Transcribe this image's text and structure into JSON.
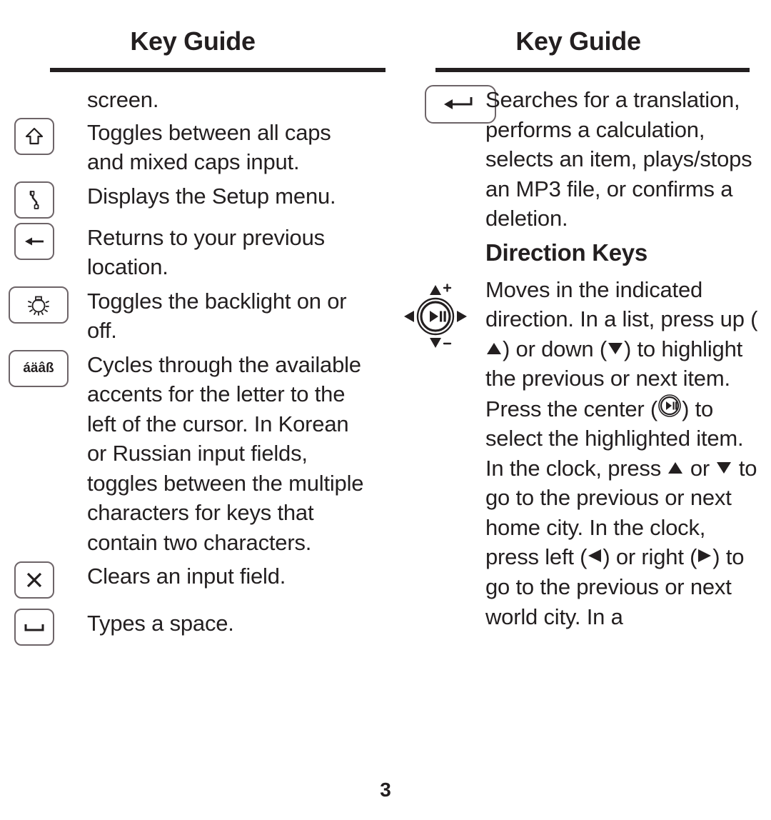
{
  "left_page": {
    "title": "Key Guide",
    "orphan_text": "screen.",
    "entries": [
      {
        "key_icon": "shift-key-icon",
        "key_label": "",
        "description": "Toggles between all caps and mixed caps input."
      },
      {
        "key_icon": "setup-wrench-key-icon",
        "key_label": "",
        "description": "Displays the Setup menu."
      },
      {
        "key_icon": "back-arrow-key-icon",
        "key_label": "",
        "description": "Returns to your previous location."
      },
      {
        "key_icon": "backlight-bulb-key-icon",
        "key_label": "",
        "description": "Toggles the backlight on or off."
      },
      {
        "key_icon": "accent-key-icon",
        "key_label": "áäâß",
        "description": "Cycles through the available accents for the letter to the left of the cursor. In Korean or Russian input fields, toggles between the multiple characters for keys that contain two characters."
      },
      {
        "key_icon": "clear-x-key-icon",
        "key_label": "X",
        "description": "Clears an input field."
      },
      {
        "key_icon": "space-bar-key-icon",
        "key_label": "",
        "description": "Types a space."
      }
    ]
  },
  "right_page": {
    "title": "Key Guide",
    "enter_entry": {
      "key_icon": "enter-return-key-icon",
      "description": "Searches for a translation, performs a calculation, selects an item, plays/stops an MP3 file, or confirms a deletion."
    },
    "subheading": "Direction Keys",
    "dpad": {
      "icon": "direction-pad-icon",
      "up_label": "+",
      "down_label": "-",
      "center_icon": "play-pause-icon"
    },
    "direction_text": {
      "part1": "Moves in the indicated direction. In a list, press up (",
      "part2": ") or down (",
      "part3": ") to highlight the previous or next item. Press the center (",
      "part4": ") to select the highlighted item. In the clock, press ",
      "part5": " or ",
      "part6": " to go to the previous or next home city.  In the clock, press left (",
      "part7": ") or right (",
      "part8": ") to go to the previous or next world city. In a"
    }
  },
  "folio": "3"
}
